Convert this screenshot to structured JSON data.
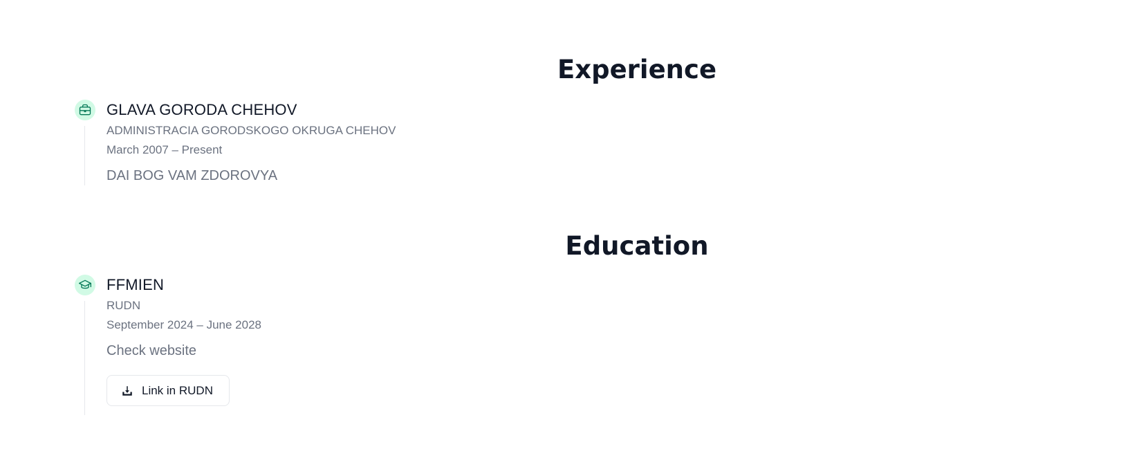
{
  "experience": {
    "section_title": "Experience",
    "items": [
      {
        "icon": "briefcase-icon",
        "title": "GLAVA GORODA CHEHOV",
        "organization": "ADMINISTRACIA GORODSKOGO OKRUGA CHEHOV",
        "dates": "March 2007 – Present",
        "description": "DAI BOG VAM ZDOROVYA"
      }
    ]
  },
  "education": {
    "section_title": "Education",
    "items": [
      {
        "icon": "graduation-cap-icon",
        "title": "FFMIEN",
        "organization": "RUDN",
        "dates": "September 2024 – June 2028",
        "description": "Check website",
        "link_label": "Link in RUDN",
        "link_icon": "download-icon"
      }
    ]
  },
  "colors": {
    "badge_background": "#d1fae5",
    "icon_color": "#047857",
    "heading": "#111827",
    "muted_text": "#6b7280",
    "border": "#e5e7eb"
  }
}
